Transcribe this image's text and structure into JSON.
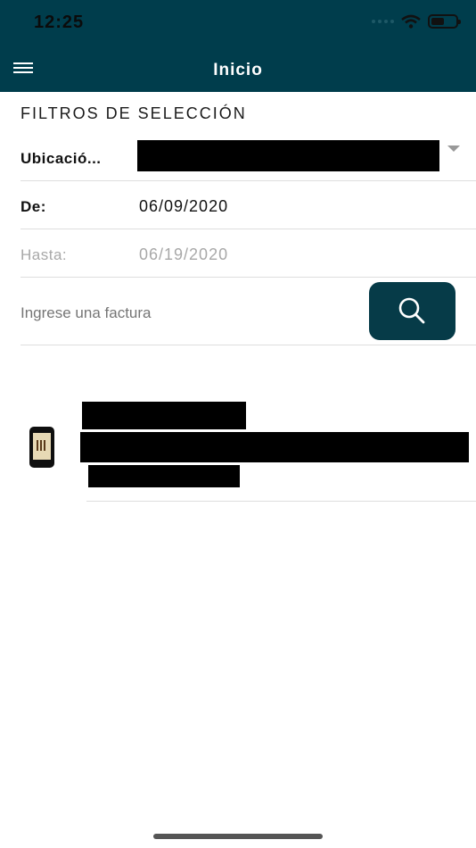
{
  "status_bar": {
    "time": "12:25"
  },
  "header": {
    "title": "Inicio",
    "menu_icon": "hamburger-icon"
  },
  "filters": {
    "section_title": "FILTROS DE SELECCIÓN",
    "location_label": "Ubicació...",
    "from_label": "De:",
    "from_value": "06/09/2020",
    "to_label": "Hasta:",
    "to_value": "06/19/2020",
    "invoice_placeholder": "Ingrese una factura",
    "search_icon": "search-icon"
  },
  "list": {
    "items": [
      {
        "icon": "phone-qr-icon"
      }
    ]
  },
  "colors": {
    "header_bg": "#003d4c",
    "search_button_bg": "#063b48"
  }
}
